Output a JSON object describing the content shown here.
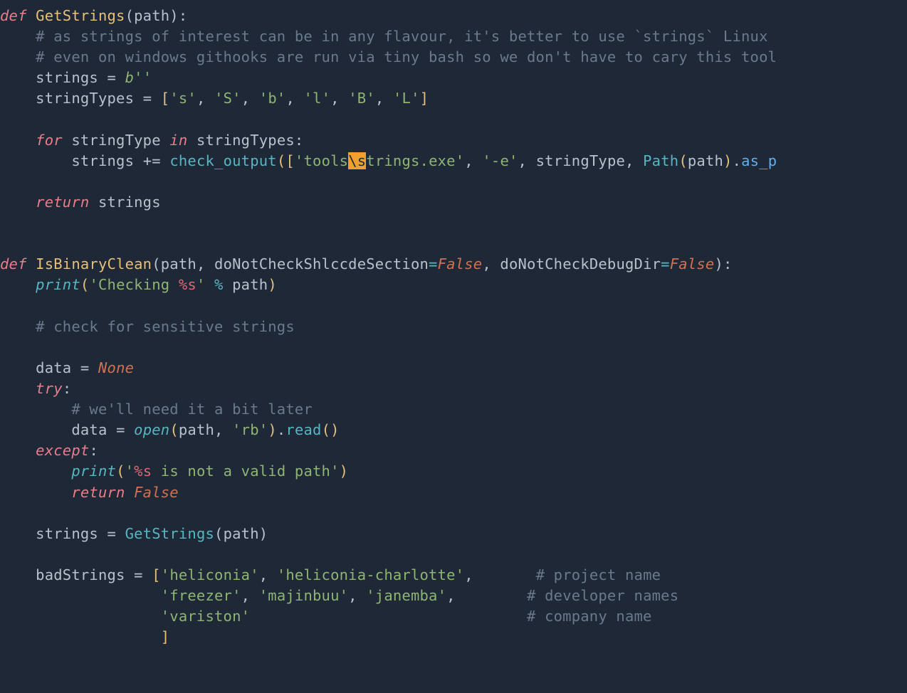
{
  "code": {
    "line1": {
      "def": "def ",
      "fn": "GetStrings",
      "sig": "(path):"
    },
    "line2": "    # as strings of interest can be in any flavour, it's better to use `strings` Linux ",
    "line3": "    # even on windows githooks are run via tiny bash so we don't have to cary this tool",
    "line4": {
      "pre": "    strings ",
      "eq": "= ",
      "b": "b",
      "s": "''"
    },
    "line5": {
      "pre": "    stringTypes ",
      "eq": "= ",
      "open": "[",
      "items": [
        "'s'",
        "'S'",
        "'b'",
        "'l'",
        "'B'",
        "'L'"
      ],
      "close": "]"
    },
    "line6": "",
    "line7": {
      "indent": "    ",
      "for": "for ",
      "v": "stringType ",
      "in": "in ",
      "it": "stringTypes",
      ":": ":"
    },
    "line8": {
      "indent": "        ",
      "lhs": "strings ",
      "pluseq": "+= ",
      "call": "check_output",
      "open": "([",
      "s1a": "'tools",
      "hl": "\\s",
      "s1b": "trings.exe'",
      "c1": ", ",
      "s2": "'-e'",
      "c2": ", ",
      "arg": "stringType",
      "c3": ", ",
      "path": "Path",
      "popen": "(",
      "pid": "path",
      "pclose": ")",
      "dot": ".",
      "asp": "as_p"
    },
    "line9": "",
    "line10": {
      "indent": "    ",
      "ret": "return ",
      "v": "strings"
    },
    "line11": "",
    "line12": "",
    "line13": {
      "def": "def ",
      "fn": "IsBinaryClean",
      "open": "(",
      "p1": "path",
      "c1": ", ",
      "p2": "doNotCheckShlccdeSection",
      "eq1": "=",
      "f1": "False",
      "c2": ", ",
      "p3": "doNotCheckDebugDir",
      "eq2": "=",
      "f2": "False",
      "close": "):"
    },
    "line14": {
      "indent": "    ",
      "print": "print",
      "open": "(",
      "s1": "'Checking ",
      "pct": "%s",
      "s2": "'",
      " mod": " % ",
      "arg": "path",
      "close": ")"
    },
    "line15": "",
    "line16": "    # check for sensitive strings",
    "line17": "",
    "line18": {
      "indent": "    ",
      "lhs": "data ",
      "eq": "= ",
      "none": "None"
    },
    "line19": {
      "indent": "    ",
      "try": "try",
      ":": ":"
    },
    "line20": "        # we'll need it a bit later",
    "line21": {
      "indent": "        ",
      "lhs": "data ",
      "eq": "= ",
      "open": "open",
      "popen": "(",
      "arg": "path",
      "c": ", ",
      "mode": "'rb'",
      "pclose": ")",
      "dot": ".",
      "read": "read",
      "rp": "()"
    },
    "line22": {
      "indent": "    ",
      "except": "except",
      ":": ":"
    },
    "line23": {
      "indent": "        ",
      "print": "print",
      "open": "(",
      "s1": "'",
      "pct": "%s",
      "s2": " is not a valid path'",
      "close": ")"
    },
    "line24": {
      "indent": "        ",
      "ret": "return ",
      "f": "False"
    },
    "line25": "",
    "line26": {
      "indent": "    ",
      "lhs": "strings ",
      "eq": "= ",
      "call": "GetStrings",
      "args": "(path)"
    },
    "line27": "",
    "line28": {
      "indent": "    ",
      "lhs": "badStrings ",
      "eq": "= ",
      "open": "[",
      "s1": "'heliconia'",
      "c1": ", ",
      "s2": "'heliconia-charlotte'",
      "c2": ",",
      "pad": "       ",
      "cmt": "# project name"
    },
    "line29": {
      "indent": "                  ",
      "s1": "'freezer'",
      "c1": ", ",
      "s2": "'majinbuu'",
      "c2": ", ",
      "s3": "'janemba'",
      "c3": ",",
      "pad": "        ",
      "cmt": "# developer names"
    },
    "line30": {
      "indent": "                  ",
      "s1": "'variston'",
      "pad": "                               ",
      "cmt": "# company name"
    },
    "line31": {
      "indent": "                  ",
      "close": "]"
    }
  }
}
